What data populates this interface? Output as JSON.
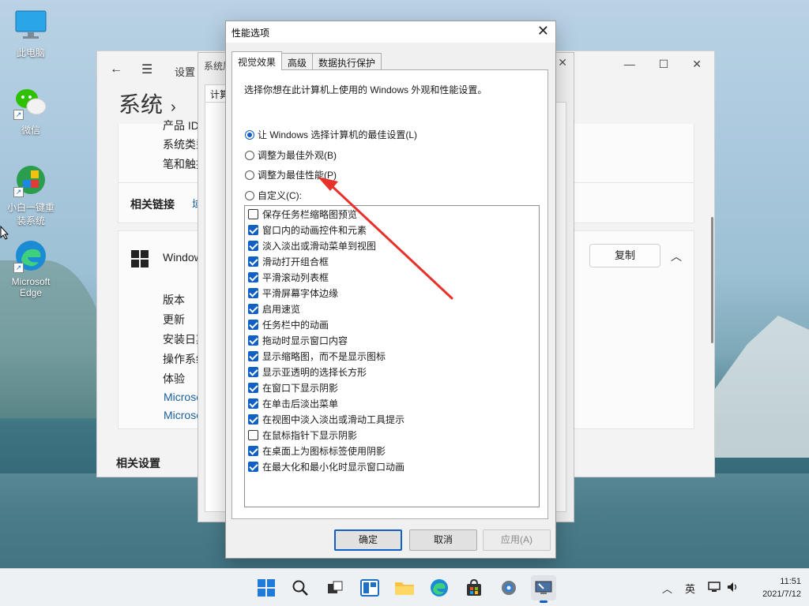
{
  "desktop": {
    "icons": [
      {
        "label": "此电脑"
      },
      {
        "label": "微信"
      },
      {
        "label": "小白一键重装系统"
      },
      {
        "label": "Microsoft Edge"
      }
    ]
  },
  "settings_window": {
    "app_title": "设置",
    "page_title": "系统",
    "lines": [
      "产品 ID",
      "系统类型",
      "笔和触控"
    ],
    "related_links_label": "相关链接",
    "related_link_first": "域",
    "windows_spec_label": "Windows",
    "copy_button": "复制",
    "spec_rows": [
      "版本",
      "更新",
      "安装日期",
      "操作系统",
      "体验"
    ],
    "ms_links": [
      "Microsoft",
      "Microsoft"
    ],
    "related_settings": "相关设置"
  },
  "sysprops_window": {
    "tab_left": "系统属性",
    "tab_inner": "计算"
  },
  "perf_dialog": {
    "title": "性能选项",
    "tabs": [
      "视觉效果",
      "高级",
      "数据执行保护"
    ],
    "description": "选择你想在此计算机上使用的 Windows 外观和性能设置。",
    "radios": [
      {
        "label": "让 Windows 选择计算机的最佳设置(L)",
        "selected": true
      },
      {
        "label": "调整为最佳外观(B)",
        "selected": false
      },
      {
        "label": "调整为最佳性能(P)",
        "selected": false
      },
      {
        "label": "自定义(C):",
        "selected": false
      }
    ],
    "checkboxes": [
      {
        "label": "保存任务栏缩略图预览",
        "checked": false
      },
      {
        "label": "窗口内的动画控件和元素",
        "checked": true
      },
      {
        "label": "淡入淡出或滑动菜单到视图",
        "checked": true
      },
      {
        "label": "滑动打开组合框",
        "checked": true
      },
      {
        "label": "平滑滚动列表框",
        "checked": true
      },
      {
        "label": "平滑屏幕字体边缘",
        "checked": true
      },
      {
        "label": "启用速览",
        "checked": true
      },
      {
        "label": "任务栏中的动画",
        "checked": true
      },
      {
        "label": "拖动时显示窗口内容",
        "checked": true
      },
      {
        "label": "显示缩略图，而不是显示图标",
        "checked": true
      },
      {
        "label": "显示亚透明的选择长方形",
        "checked": true
      },
      {
        "label": "在窗口下显示阴影",
        "checked": true
      },
      {
        "label": "在单击后淡出菜单",
        "checked": true
      },
      {
        "label": "在视图中淡入淡出或滑动工具提示",
        "checked": true
      },
      {
        "label": "在鼠标指针下显示阴影",
        "checked": false
      },
      {
        "label": "在桌面上为图标标签使用阴影",
        "checked": true
      },
      {
        "label": "在最大化和最小化时显示窗口动画",
        "checked": true
      }
    ],
    "buttons": {
      "ok": "确定",
      "cancel": "取消",
      "apply": "应用(A)"
    }
  },
  "taskbar": {
    "icons": [
      "windows-start-icon",
      "search-icon",
      "task-view-icon",
      "widgets-icon",
      "file-explorer-icon",
      "edge-icon",
      "store-icon",
      "settings-icon",
      "system-properties-icon"
    ],
    "ime": "英",
    "time": "11:51",
    "date": "2021/7/12"
  }
}
